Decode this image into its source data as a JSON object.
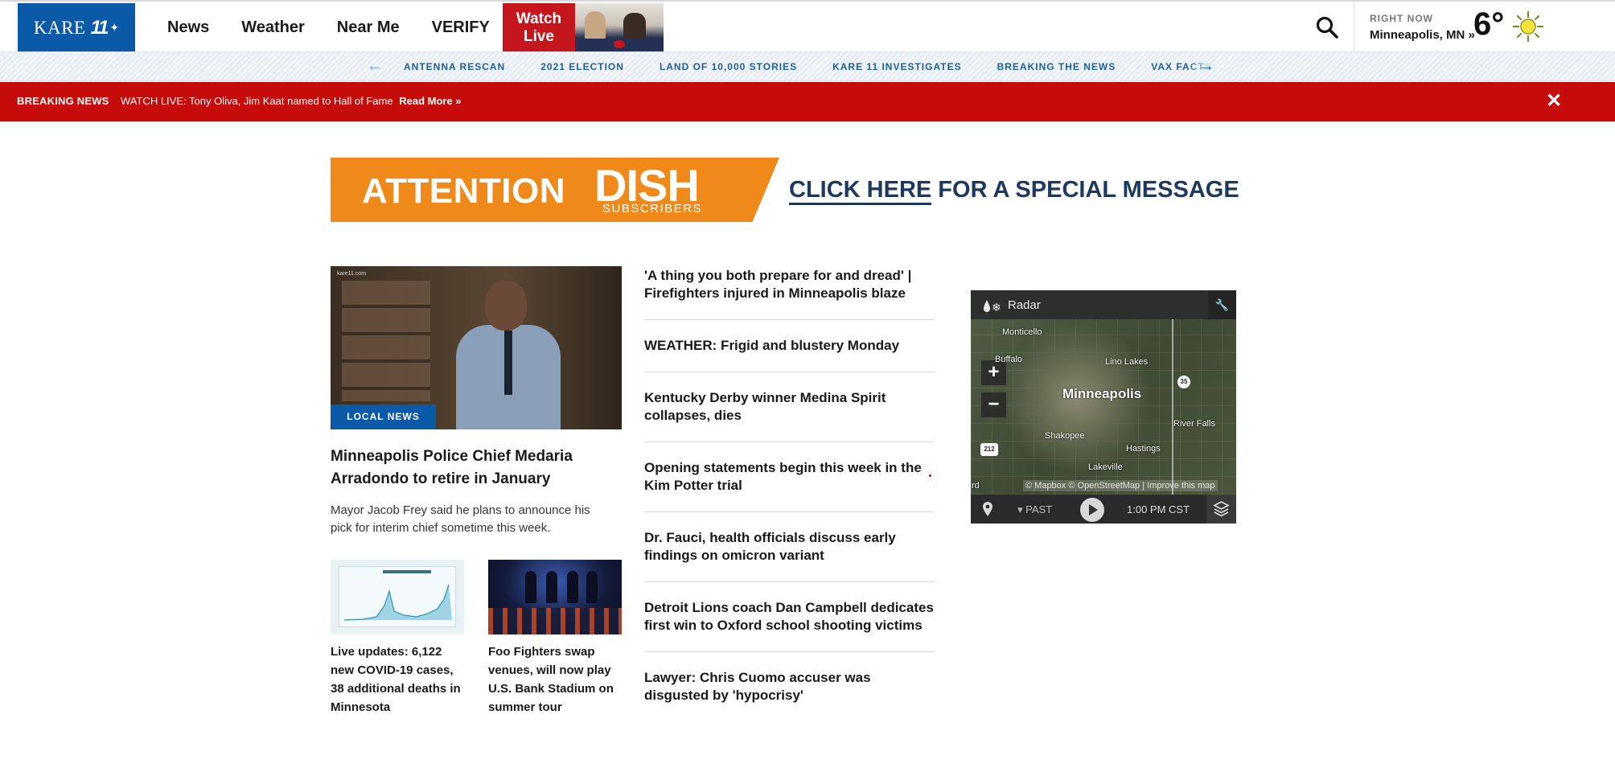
{
  "header": {
    "logo_text": "KARE",
    "logo_number": "11",
    "nav": [
      "News",
      "Weather",
      "Near Me",
      "VERIFY"
    ],
    "watch_live_line1": "Watch",
    "watch_live_line2": "Live",
    "right_now_label": "RIGHT NOW",
    "location": "Minneapolis, MN »",
    "temperature": "6°",
    "weather_icon": "sun-icon"
  },
  "topics": [
    "ANTENNA RESCAN",
    "2021 ELECTION",
    "LAND OF 10,000 STORIES",
    "KARE 11 INVESTIGATES",
    "BREAKING THE NEWS",
    "VAX FACTS"
  ],
  "breaking": {
    "tag": "BREAKING NEWS",
    "message": "WATCH LIVE: Tony Oliva, Jim Kaat named to Hall of Fame",
    "link": "Read More »",
    "close": "✕"
  },
  "ad": {
    "word1": "ATTENTION",
    "word2": "DISH",
    "word3": "SUBSCRIBERS",
    "cta_underlined": "CLICK HERE",
    "cta_rest": " FOR A SPECIAL MESSAGE"
  },
  "lead": {
    "tag": "LOCAL NEWS",
    "image_watermark": "kare11.com",
    "title": "Minneapolis Police Chief Medaria Arradondo to retire in January",
    "description": "Mayor Jacob Frey said he plans to announce his pick for interim chief sometime this week."
  },
  "cards": [
    {
      "title": "Live updates: 6,122 new COVID-19 cases, 38 additional deaths in Minnesota"
    },
    {
      "title": "Foo Fighters swap venues, will now play U.S. Bank Stadium on summer tour"
    }
  ],
  "headlines": [
    "'A thing you both prepare for and dread' | Firefighters injured in Minneapolis blaze",
    "WEATHER: Frigid and blustery Monday",
    "Kentucky Derby winner Medina Spirit collapses, dies",
    "Opening statements begin this week in the Kim Potter trial",
    "Dr. Fauci, health officials discuss early findings on omicron variant",
    "Detroit Lions coach Dan Campbell dedicates first win to Oxford school shooting victims",
    "Lawyer: Chris Cuomo accuser was disgusted by 'hypocrisy'"
  ],
  "radar": {
    "title": "Radar",
    "cities": {
      "monticello": "Monticello",
      "buffalo": "Buffalo",
      "lino_lakes": "Lino Lakes",
      "minneapolis": "Minneapolis",
      "shakopee": "Shakopee",
      "river_falls": "River Falls",
      "hastings": "Hastings",
      "lakeville": "Lakeville",
      "edge": "rd"
    },
    "hwy_35": "35",
    "hwy_212": "212",
    "zoom_in": "+",
    "zoom_out": "−",
    "attribution": "© Mapbox © OpenStreetMap | Improve this map",
    "past_label": "PAST",
    "time": "1:00 PM CST"
  },
  "colors": {
    "brand_blue": "#0b5aa8",
    "breaking_red": "#c60b0b",
    "ad_orange": "#ef8a1a",
    "ad_navy": "#1e3960"
  }
}
